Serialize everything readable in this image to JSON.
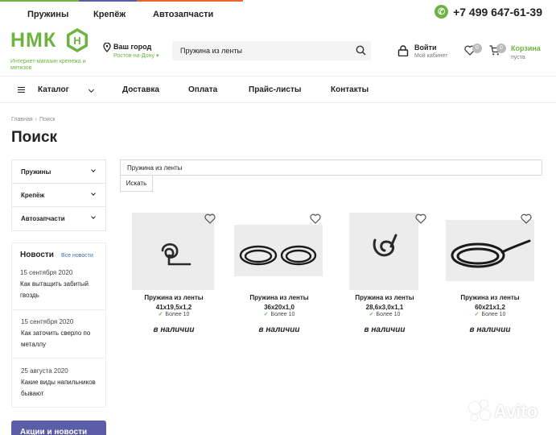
{
  "topnav": {
    "items": [
      "Пружины",
      "Крепёж",
      "Автозапчасти"
    ],
    "stripe_colors": [
      "#6cb43f",
      "#5b5ea6",
      "#e8672b"
    ]
  },
  "phone": {
    "icon": "phone-icon",
    "number": "+7 499 647-61-39"
  },
  "logo": {
    "word": "НМК",
    "letter": "Н",
    "tagline": "Интернет-магазин крепежа и метизов"
  },
  "city": {
    "label": "Ваш город",
    "value": "Ростов-на-Дону"
  },
  "search": {
    "value": "Пружина из ленты",
    "icon": "search-icon"
  },
  "account": {
    "label": "Войти",
    "sub": "Мой кабинет"
  },
  "favorites": {
    "count": "0"
  },
  "cart": {
    "count": "0",
    "label": "Корзина",
    "sub": "пуста"
  },
  "mainnav": {
    "catalog": "Каталог",
    "links": [
      "Доставка",
      "Оплата",
      "Прайс-листы",
      "Контакты"
    ]
  },
  "breadcrumb": {
    "home": "Главная",
    "current": "Поиск"
  },
  "page": {
    "title": "Поиск"
  },
  "sidebar": {
    "categories": [
      "Пружины",
      "Крепёж",
      "Автозапчасти"
    ]
  },
  "news": {
    "title": "Новости",
    "all_link": "Все новости",
    "items": [
      {
        "date": "15 сентября 2020",
        "title": "Как вытащить забитый гвоздь"
      },
      {
        "date": "15 сентября 2020",
        "title": "Как заточить сверло по металлу"
      },
      {
        "date": "25 августа 2020",
        "title": "Какие виды напильников бывают"
      }
    ]
  },
  "promo": {
    "label": "Акции и новости"
  },
  "query": {
    "value": "Пружина из ленты",
    "button": "Искать"
  },
  "products": [
    {
      "name": "Пружина из ленты",
      "size": "41х19,5х1,2",
      "stock": "Более 10",
      "availability": "в наличии"
    },
    {
      "name": "Пружина из ленты",
      "size": "36х20х1,0",
      "stock": "Более 10",
      "availability": "в наличии"
    },
    {
      "name": "Пружина из ленты",
      "size": "28,6х3,0х1,1",
      "stock": "Более 10",
      "availability": "в наличии"
    },
    {
      "name": "Пружина из ленты",
      "size": "60х21х1,2",
      "stock": "Более 10",
      "availability": "в наличии"
    }
  ],
  "watermark": {
    "text": "Avito"
  },
  "colors": {
    "brand_green": "#6cb43f",
    "promo_purple": "#5b5ea6",
    "link_blue": "#3c6fb0"
  }
}
